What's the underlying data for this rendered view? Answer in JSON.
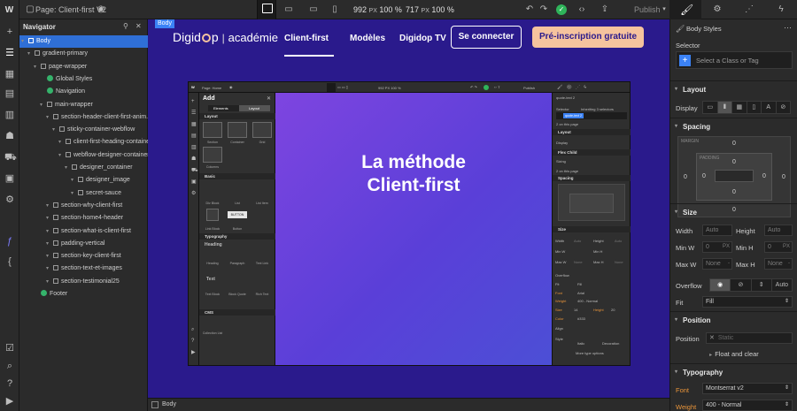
{
  "topbar": {
    "logo": "W",
    "page_label": "Page: Client-first V2",
    "width_value": "992",
    "width_unit": "PX",
    "zoom": "100 %",
    "height_value": "717",
    "height_unit": "PX",
    "zoom2": "100 %",
    "publish_label": "Publish"
  },
  "navigator": {
    "title": "Navigator",
    "items": [
      {
        "label": "Body",
        "depth": 0,
        "selected": true
      },
      {
        "label": "gradient-primary",
        "depth": 1
      },
      {
        "label": "page-wrapper",
        "depth": 2
      },
      {
        "label": "Global Styles",
        "depth": 3,
        "global": true
      },
      {
        "label": "Navigation",
        "depth": 3,
        "global": true
      },
      {
        "label": "main-wrapper",
        "depth": 3
      },
      {
        "label": "section-header-client-first-anim...",
        "depth": 4
      },
      {
        "label": "sticky-container-webflow",
        "depth": 5
      },
      {
        "label": "client-first-heading-containe...",
        "depth": 6
      },
      {
        "label": "webflow-designer-container",
        "depth": 6
      },
      {
        "label": "designer_container",
        "depth": 7
      },
      {
        "label": "designer_image",
        "depth": 8
      },
      {
        "label": "secret-sauce",
        "depth": 8
      },
      {
        "label": "section-why-client-first",
        "depth": 4
      },
      {
        "label": "section-home4-header",
        "depth": 4
      },
      {
        "label": "section-what-is-client-first",
        "depth": 4
      },
      {
        "label": "padding-vertical",
        "depth": 4
      },
      {
        "label": "section-key-client-first",
        "depth": 4
      },
      {
        "label": "section-text-et-images",
        "depth": 4
      },
      {
        "label": "section-testimonial25",
        "depth": 4
      },
      {
        "label": "Footer",
        "depth": 2,
        "global": true
      }
    ]
  },
  "canvas": {
    "body_tag": "Body",
    "brand_left": "Digid",
    "brand_right": "p",
    "brand_sep": "|",
    "brand_academie": "académie",
    "links": [
      "Client-first",
      "Modèles",
      "Digidop TV"
    ],
    "login_button": "Se connecter",
    "signup_button": "Pré-inscription gratuite",
    "breadcrumb": "Body",
    "colors": {
      "accent": "#f5c39e",
      "canvas_bg": "#2a1a8c"
    }
  },
  "inner": {
    "page_label": "Page: Home",
    "size_label": "992 PX  100 %",
    "publish": "Publish",
    "hero_line1": "La méthode",
    "hero_line2": "Client-first",
    "add_title": "Add",
    "tab_elements": "Elements",
    "tab_layout": "Layout",
    "sec_layout": "Layout",
    "layout_items": [
      "Section",
      "Container",
      "Grid",
      "Columns"
    ],
    "sec_basic": "Basic",
    "basic_items": [
      "Div Block",
      "List",
      "List Item",
      "Link Block",
      "Button"
    ],
    "button_text": "BUTTON",
    "sec_typography": "Typography",
    "typo_items": [
      "Heading",
      "Paragraph",
      "Text Link",
      "Text Block",
      "Block Quote",
      "Rich Text"
    ],
    "heading_text": "Heading",
    "text_text": "Text",
    "sec_cms": "CMS",
    "cms_item": "Collection List",
    "style": {
      "class_label": "quote-text 2",
      "selector": "Selector",
      "inheriting": "Inheriting 3 selectors",
      "class_pill": "quote-text 2",
      "on_page": "2 on this page",
      "layout": "Layout",
      "display": "Display",
      "flex_child": "Flex Child",
      "sizing": "Sizing",
      "on_page2": "2 on this page",
      "spacing": "Spacing",
      "size": "Size",
      "width": "Width",
      "height": "Height",
      "auto": "Auto",
      "min_w": "Min W",
      "min_h": "Min H",
      "max_w": "Max W",
      "max_h": "Max H",
      "none": "None",
      "overflow": "Overflow",
      "fit": "Fit",
      "fill": "Fill",
      "font": "Font",
      "font_val": "Arial",
      "weight": "Weight",
      "weight_val": "400 - Normal",
      "size_lbl": "Size",
      "size_val": "14",
      "px": "PX",
      "height_lbl": "Height",
      "height_val": "20",
      "color": "Color",
      "color_val": "#333",
      "align": "Align",
      "style_lbl": "Style",
      "italic": "Italic",
      "decoration": "Decoration",
      "more": "More type options"
    }
  },
  "style_panel": {
    "title": "Body Styles",
    "selector_label": "Selector",
    "selector_placeholder": "Select a Class or Tag",
    "layout_title": "Layout",
    "display_label": "Display",
    "spacing_title": "Spacing",
    "margin_label": "MARGIN",
    "padding_label": "PADDING",
    "zero": "0",
    "size_title": "Size",
    "width_label": "Width",
    "height_label": "Height",
    "auto": "Auto",
    "min_w_label": "Min W",
    "min_h_label": "Min H",
    "max_w_label": "Max W",
    "max_h_label": "Max H",
    "px": "PX",
    "none": "None",
    "overflow_label": "Overflow",
    "overflow_auto": "Auto",
    "fit_label": "Fit",
    "fit_value": "Fill",
    "position_title": "Position",
    "position_label": "Position",
    "position_value": "Static",
    "float_label": "Float and clear",
    "typography_title": "Typography",
    "font_label": "Font",
    "font_value": "Montserrat v2",
    "weight_label": "Weight",
    "weight_value": "400 - Normal",
    "colors": {
      "font_label": "#e8943a"
    }
  }
}
